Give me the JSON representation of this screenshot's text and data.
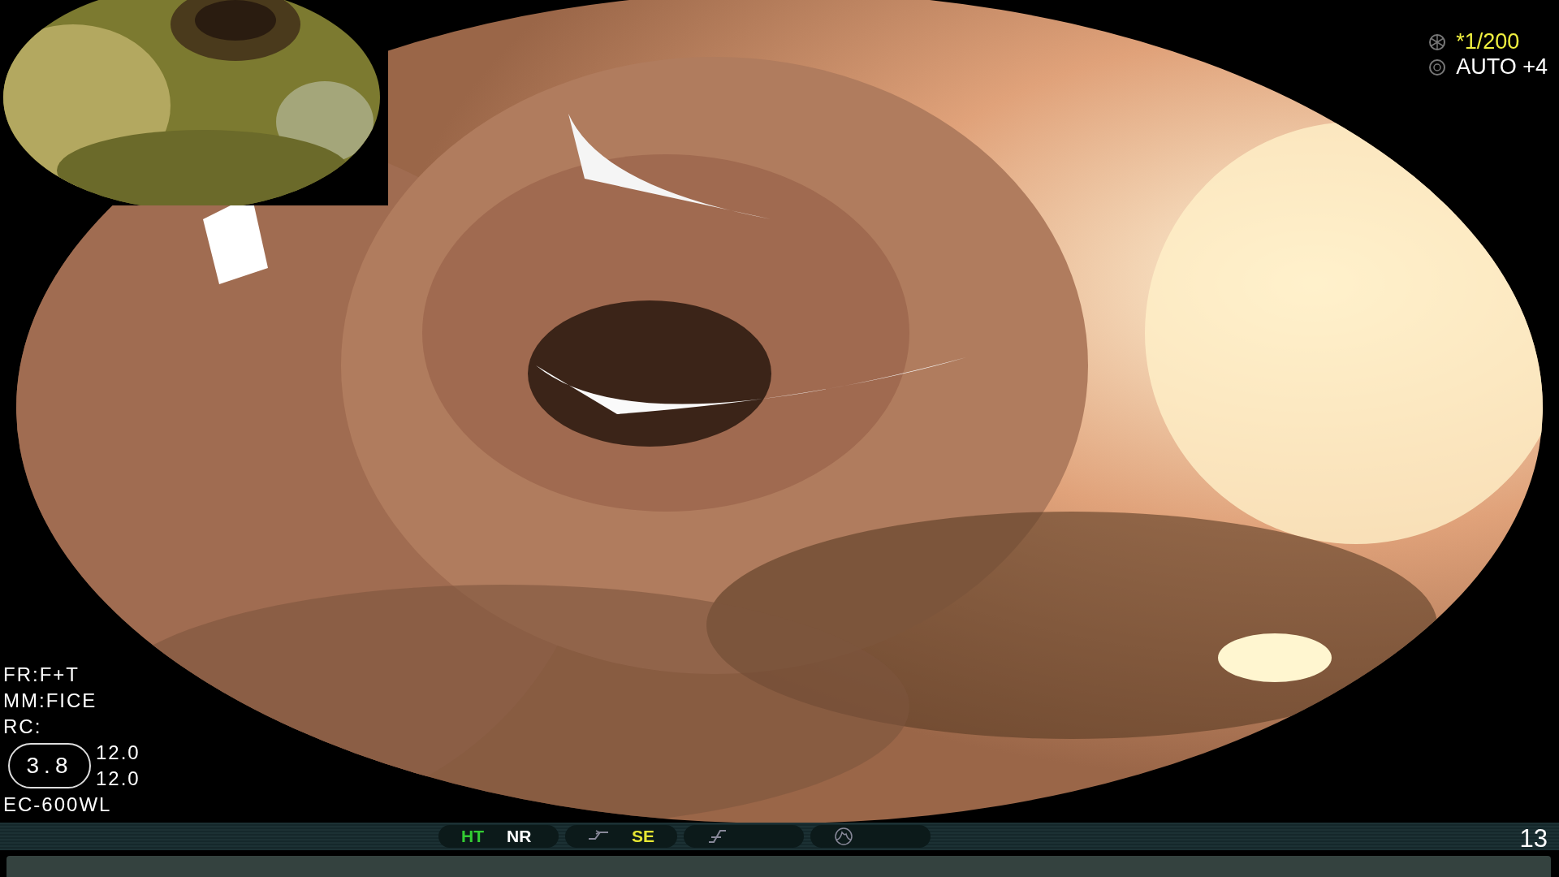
{
  "exposure": {
    "shutter": "*1/200",
    "iris": "AUTO +4"
  },
  "settings": [
    "FR:F+T",
    "MM:FICE",
    "RC:"
  ],
  "zoom": {
    "badge": "3.8",
    "values": [
      "12.0",
      "12.0"
    ]
  },
  "scope": "EC-600WL",
  "status_bar": {
    "groups": [
      {
        "items": [
          {
            "kind": "text",
            "text": "HT",
            "color": "#33cc33"
          },
          {
            "kind": "text",
            "text": "NR",
            "color": "#ffffff"
          }
        ]
      },
      {
        "items": [
          {
            "kind": "tone"
          },
          {
            "kind": "text",
            "text": "SE",
            "color": "#e6e633"
          }
        ]
      },
      {
        "items": [
          {
            "kind": "slope"
          }
        ]
      },
      {
        "items": [
          {
            "kind": "peak"
          }
        ]
      }
    ],
    "frame_number": "13"
  }
}
